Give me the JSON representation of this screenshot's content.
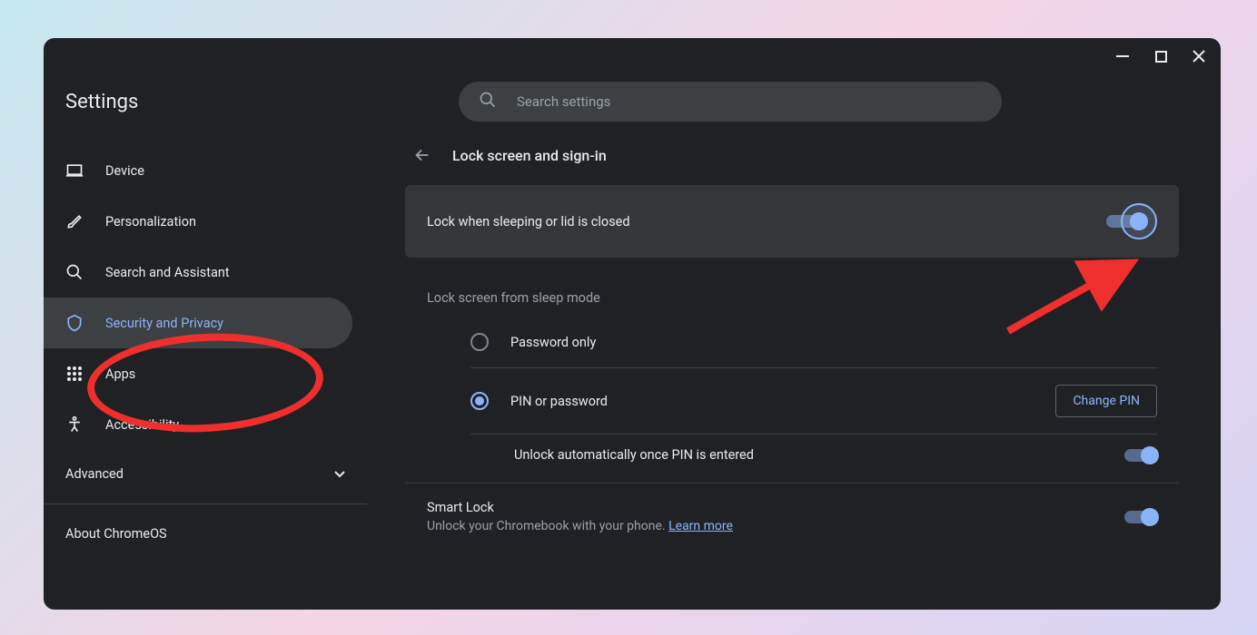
{
  "app": {
    "title": "Settings"
  },
  "search": {
    "placeholder": "Search settings"
  },
  "sidebar": {
    "items": [
      {
        "label": "Device",
        "icon": "laptop"
      },
      {
        "label": "Personalization",
        "icon": "brush"
      },
      {
        "label": "Search and Assistant",
        "icon": "search"
      },
      {
        "label": "Security and Privacy",
        "icon": "shield"
      },
      {
        "label": "Apps",
        "icon": "grid"
      },
      {
        "label": "Accessibility",
        "icon": "accessibility"
      }
    ],
    "advanced": "Advanced",
    "about": "About ChromeOS"
  },
  "page": {
    "title": "Lock screen and sign-in"
  },
  "settings": {
    "lock_sleep": {
      "label": "Lock when sleeping or lid is closed",
      "enabled": true
    },
    "section_title": "Lock screen from sleep mode",
    "radios": {
      "password_only": "Password only",
      "pin_or_password": "PIN or password"
    },
    "change_pin": "Change PIN",
    "auto_unlock": {
      "label": "Unlock automatically once PIN is entered",
      "enabled": true
    },
    "smart_lock": {
      "title": "Smart Lock",
      "description": "Unlock your Chromebook with your phone. ",
      "learn_more": "Learn more",
      "enabled": true
    }
  }
}
